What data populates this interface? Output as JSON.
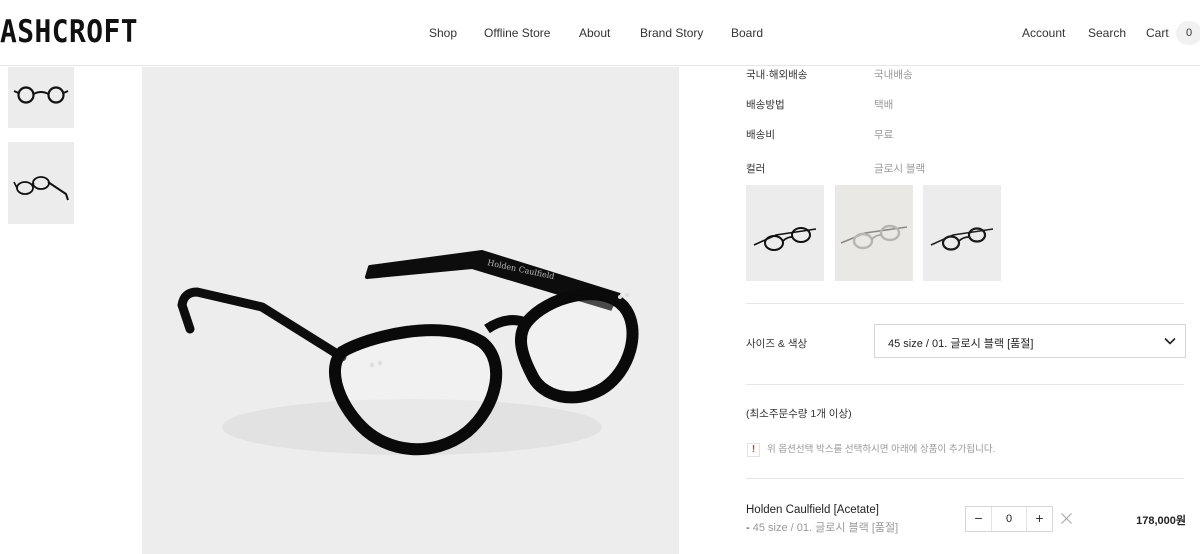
{
  "brand": {
    "logo_text": "ASHCROFT"
  },
  "nav": {
    "left": [
      "Shop",
      "Offline Store",
      "About",
      "Brand Story",
      "Board"
    ],
    "right": [
      "Account",
      "Search",
      "Cart"
    ],
    "cart_count": "0"
  },
  "gallery": {
    "thumbnails": [
      "glasses-front-thumbnail",
      "glasses-folded-thumbnail"
    ],
    "main_image": "glasses-angled-photo",
    "frame_inscription": "Holden Caulfield"
  },
  "info": {
    "rows": [
      {
        "label": "국내·해외배송",
        "value": "국내배송"
      },
      {
        "label": "배송방법",
        "value": "택배"
      },
      {
        "label": "배송비",
        "value": "무료"
      },
      {
        "label": "컬러",
        "value": "글로시 블랙"
      }
    ],
    "color_swatches": [
      "glossy-black-swatch",
      "clear-swatch",
      "black-swatch"
    ]
  },
  "option": {
    "label": "사이즈 & 색상",
    "selected": "45 size / 01. 글로시 블랙 [품절]"
  },
  "min_order_text": "(최소주문수량 1개 이상)",
  "notice_text": "위 옵션선택 박스를 선택하시면 아래에 상품이 추가됩니다.",
  "selected_item": {
    "name": "Holden Caulfield [Acetate]",
    "dash": "-",
    "option": "45 size / 01. 글로시 블랙 [품절]",
    "quantity": "0",
    "minus": "−",
    "plus": "+",
    "price": "178,000원"
  },
  "colors": {
    "accent_warning": "#d23a3a",
    "text_muted": "#999999"
  }
}
